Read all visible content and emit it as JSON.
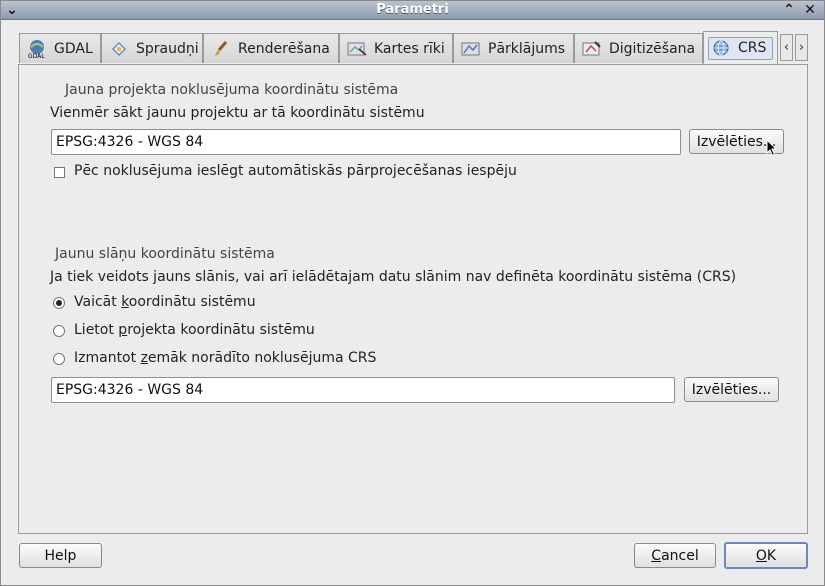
{
  "window": {
    "title": "Parametri",
    "menu_glyph": "⌄",
    "maximize_glyph": "⌃",
    "close_glyph": "✕"
  },
  "tabs": [
    {
      "label": "GDAL",
      "icon": "gdal-icon"
    },
    {
      "label": "Spraudņi",
      "icon": "plugin-icon"
    },
    {
      "label": "Renderēšana",
      "icon": "brush-icon"
    },
    {
      "label": "Kartes rīki",
      "icon": "map-tools-icon"
    },
    {
      "label": "Pārklājums",
      "icon": "overlay-icon"
    },
    {
      "label": "Digitizēšana",
      "icon": "digitize-icon"
    },
    {
      "label": "CRS",
      "icon": "globe-icon"
    }
  ],
  "tab_scroll": {
    "left": "‹",
    "right": "›"
  },
  "project_crs": {
    "group_title": "Jauna projekta noklusējuma koordinātu sistēma",
    "description": "Vienmēr sākt jaunu projektu ar tā koordinātu sistēmu",
    "value": "EPSG:4326 - WGS 84",
    "select_button": "Izvēlēties...",
    "auto_reproject_label": "Pēc noklusējuma ieslēgt automātiskās pārprojecēšanas iespēju",
    "auto_reproject_checked": false
  },
  "layer_crs": {
    "group_title": "Jaunu slāņu koordinātu sistēma",
    "description": "Ja tiek veidots jauns slānis, vai arī ielādētajam datu slānim nav definēta koordinātu sistēma (CRS)",
    "options": [
      {
        "pre": "Vaicāt ",
        "key": "k",
        "post": "oordinātu sistēmu",
        "selected": true
      },
      {
        "pre": "Lietot ",
        "key": "p",
        "post": "rojekta koordinātu sistēmu",
        "selected": false
      },
      {
        "pre": "Izmantot ",
        "key": "z",
        "post": "emāk norādīto noklusējuma CRS",
        "selected": false
      }
    ],
    "value": "EPSG:4326 - WGS 84",
    "select_button": "Izvēlēties..."
  },
  "footer": {
    "help": "Help",
    "cancel_key": "C",
    "cancel_rest": "ancel",
    "ok_key": "O",
    "ok_rest": "K"
  }
}
